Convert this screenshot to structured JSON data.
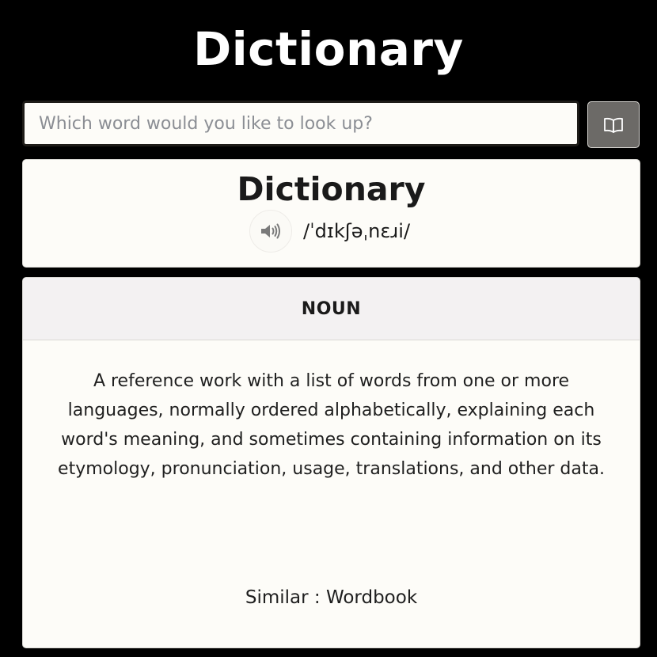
{
  "app": {
    "title": "Dictionary"
  },
  "search": {
    "placeholder": "Which word would you like to look up?",
    "value": "",
    "button_icon": "book-icon"
  },
  "entry": {
    "word": "Dictionary",
    "phonetic": "/ˈdɪkʃəˌnɛɹi/",
    "audio_icon": "speaker-icon",
    "part_of_speech": "NOUN",
    "definition": "A reference work with a list of words from one or more languages, normally ordered alphabetically, explaining each word's meaning, and sometimes containing information on its etymology, pronunciation, usage, translations, and other data.",
    "similar": "Similar : Wordbook"
  },
  "colors": {
    "background": "#000000",
    "card": "#fdfcf8",
    "button": "#6c6a67",
    "header_band": "#f3f1f2"
  }
}
